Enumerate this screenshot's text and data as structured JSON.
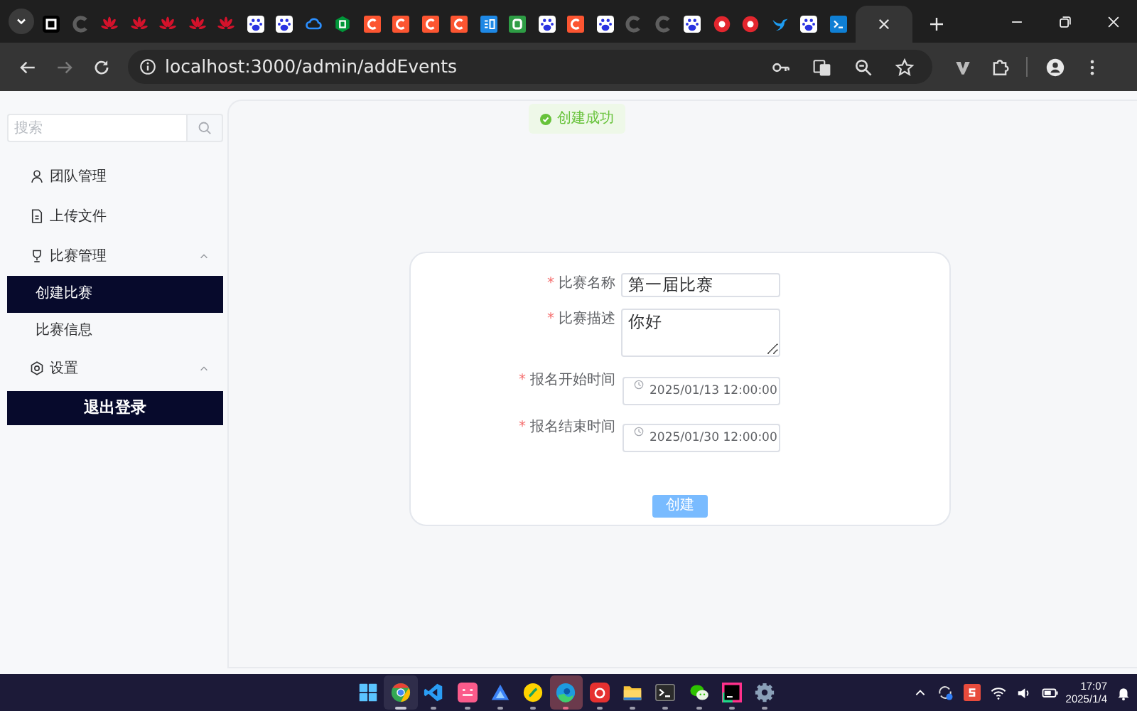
{
  "browser": {
    "tabs": [
      {
        "kind": "k",
        "selected": false
      },
      {
        "kind": "cgray",
        "selected": false
      },
      {
        "kind": "huawei",
        "selected": false
      },
      {
        "kind": "huawei",
        "selected": false
      },
      {
        "kind": "huawei",
        "selected": false
      },
      {
        "kind": "huawei",
        "selected": false
      },
      {
        "kind": "huawei",
        "selected": false
      },
      {
        "kind": "baidu",
        "selected": false
      },
      {
        "kind": "baidu",
        "selected": false
      },
      {
        "kind": "cloud",
        "selected": false
      },
      {
        "kind": "hex",
        "selected": false
      },
      {
        "kind": "corange",
        "selected": false
      },
      {
        "kind": "corange",
        "selected": false
      },
      {
        "kind": "corange",
        "selected": false
      },
      {
        "kind": "corange",
        "selected": false
      },
      {
        "kind": "yi",
        "selected": false
      },
      {
        "kind": "u",
        "selected": false
      },
      {
        "kind": "baidu",
        "selected": false
      },
      {
        "kind": "corange",
        "selected": false
      },
      {
        "kind": "baidu",
        "selected": false
      },
      {
        "kind": "cgray",
        "selected": false
      },
      {
        "kind": "cgray",
        "selected": false
      },
      {
        "kind": "baidu",
        "selected": false
      },
      {
        "kind": "red",
        "selected": false
      },
      {
        "kind": "red",
        "selected": false
      },
      {
        "kind": "bird",
        "selected": false
      },
      {
        "kind": "baidu",
        "selected": false
      },
      {
        "kind": "term",
        "selected": false
      },
      {
        "kind": "hidden",
        "selected": true
      }
    ],
    "forward_disabled": true,
    "address": "localhost:3000/admin/addEvents"
  },
  "sidebar": {
    "search": {
      "placeholder": "搜索"
    },
    "items": [
      {
        "label": "团队管理"
      },
      {
        "label": "上传文件"
      },
      {
        "label": "比赛管理",
        "expanded": true,
        "children": [
          {
            "label": "创建比赛",
            "selected": true
          },
          {
            "label": "比赛信息",
            "selected": false
          }
        ]
      },
      {
        "label": "设置",
        "expanded": true
      }
    ],
    "logout_button": "退出登录"
  },
  "toast": {
    "text": "创建成功"
  },
  "form": {
    "required_mark": "*",
    "fields": [
      {
        "kind": "text",
        "label": "比赛名称",
        "required": true,
        "value": "第一届比赛"
      },
      {
        "kind": "textarea",
        "label": "比赛描述",
        "required": true,
        "value": "你好"
      },
      {
        "kind": "datetime",
        "label": "报名开始时间",
        "required": true,
        "value": "2025/01/13 12:00:00"
      },
      {
        "kind": "datetime",
        "label": "报名结束时间",
        "required": true,
        "value": "2025/01/30 12:00:00"
      }
    ],
    "submit": {
      "label": "创建",
      "disabled": true
    }
  },
  "taskbar": {
    "apps": [
      {
        "kind": "start",
        "selected": false,
        "running": false,
        "flashing": false
      },
      {
        "kind": "chrome",
        "selected": true,
        "running": true,
        "flashing": false
      },
      {
        "kind": "vscode",
        "selected": false,
        "running": true,
        "flashing": false
      },
      {
        "kind": "pink",
        "selected": false,
        "running": true,
        "flashing": false
      },
      {
        "kind": "triangle",
        "selected": false,
        "running": true,
        "flashing": false
      },
      {
        "kind": "yellow",
        "selected": false,
        "running": true,
        "flashing": false
      },
      {
        "kind": "edge",
        "selected": false,
        "running": true,
        "flashing": true
      },
      {
        "kind": "netease",
        "selected": false,
        "running": true,
        "flashing": false
      },
      {
        "kind": "folder",
        "selected": false,
        "running": true,
        "flashing": false
      },
      {
        "kind": "terminal",
        "selected": false,
        "running": true,
        "flashing": false
      },
      {
        "kind": "wechat",
        "selected": false,
        "running": true,
        "flashing": false
      },
      {
        "kind": "jetbrains",
        "selected": false,
        "running": true,
        "flashing": false
      },
      {
        "kind": "settings",
        "selected": false,
        "running": true,
        "flashing": false
      }
    ],
    "time": "17:07",
    "date": "2025/1/4"
  }
}
